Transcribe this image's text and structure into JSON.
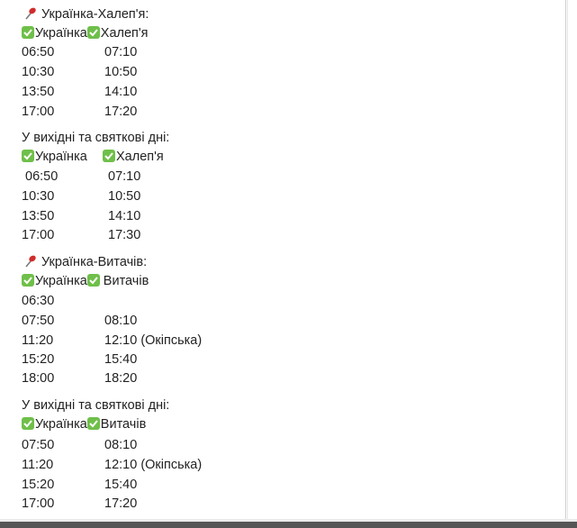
{
  "sections": [
    {
      "title": "Українка-Халеп'я:",
      "from": "Українка",
      "to": "Халеп'я",
      "rows": [
        [
          "06:50",
          "07:10"
        ],
        [
          "10:30",
          "10:50"
        ],
        [
          "13:50",
          "14:10"
        ],
        [
          "17:00",
          "17:20"
        ]
      ]
    },
    {
      "title": "У вихідні та святкові дні:",
      "from": "Українка",
      "to": "Халеп'я",
      "rows": [
        [
          "06:50",
          "07:10"
        ],
        [
          "10:30",
          "10:50"
        ],
        [
          "13:50",
          "14:10"
        ],
        [
          "17:00",
          "17:30"
        ]
      ]
    },
    {
      "title": "Українка-Витачів:",
      "from": "Українка",
      "to": "Витачів",
      "rows": [
        [
          "06:30",
          ""
        ],
        [
          "07:50",
          "08:10"
        ],
        [
          "11:20",
          "12:10 (Окіпська)"
        ],
        [
          "15:20",
          "15:40"
        ],
        [
          "18:00",
          "18:20"
        ]
      ]
    },
    {
      "title": "У вихідні та святкові дні:",
      "from": "Українка",
      "to": "Витачів",
      "rows": [
        [
          "07:50",
          "08:10"
        ],
        [
          "11:20",
          "12:10 (Окіпська)"
        ],
        [
          "15:20",
          "15:40"
        ],
        [
          "17:00",
          "17:20"
        ]
      ]
    }
  ],
  "icons": {
    "pin": "pushpin-icon",
    "check": "check-mark-icon"
  },
  "colors": {
    "pin": "#d22b2b",
    "check": "#6fbf4a",
    "text": "#222222"
  }
}
